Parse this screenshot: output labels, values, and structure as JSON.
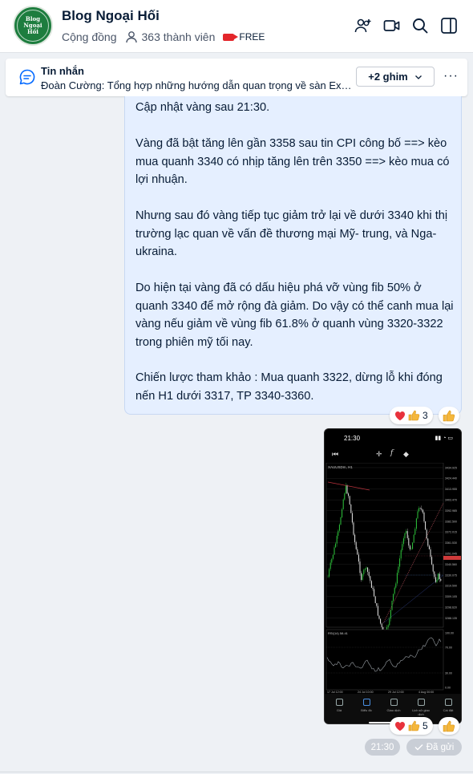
{
  "header": {
    "avatar_line1": "Blog",
    "avatar_line2": "Ngoại Hối",
    "title": "Blog Ngoại Hối",
    "category": "Cộng đồng",
    "members": "363 thành viên",
    "badge": "FREE",
    "icons": [
      "add-member-icon",
      "video-call-icon",
      "search-icon",
      "sidebar-toggle-icon"
    ]
  },
  "pinned": {
    "title": "Tin nhắn",
    "text": "Đoàn Cường: Tổng hợp những hướng dẫn quan trọng về sàn Exness",
    "pins_label": "+2 ghim",
    "more": "···"
  },
  "message": {
    "paragraphs": [
      "Cập nhật vàng sau 21:30.",
      "Vàng đã bật tăng lên gần 3358 sau tin CPI công bố ==> kèo mua quanh 3340 có nhịp tăng lên trên 3350 ==> kèo mua có lợi nhuận.",
      "Nhưng sau đó vàng tiếp tục giảm trở lại về dưới 3340 khi thị trường lạc quan về vấn đề thương mại Mỹ- trung, và Nga-ukraina.",
      "Do hiện tại vàng đã có dấu hiệu phá vỡ vùng fib 50% ở quanh 3340 để mở rộng đà giảm. Do vậy có thể canh mua lại vàng nếu giảm về vùng fib 61.8% ở quanh vùng 3320-3322 trong phiên mỹ tối nay.",
      "Chiến lược tham khảo : Mua quanh 3322, dừng lỗ khi đóng nến H1 dưới 3317, TP 3340-3360."
    ],
    "reaction_count": "3"
  },
  "image_message": {
    "status_time": "21:30",
    "symbol_label": "XAUUSDm, H1",
    "indicator_label": "RSI(14) 58.41",
    "price_ticks": [
      "3434.925",
      "3424.440",
      "3413.955",
      "3403.470",
      "3392.985",
      "3382.500",
      "3372.015",
      "3361.530",
      "3351.045",
      "3340.560",
      "3330.075",
      "3319.590",
      "3309.105",
      "3298.620",
      "3288.135"
    ],
    "rsi_ticks": [
      "100.00",
      "70.00",
      "30.00",
      "0.00"
    ],
    "date_ticks": [
      "17 Jul 12:00",
      "24 Jul 10:00",
      "29 Jul 12:00",
      "4 Aug 00:00"
    ],
    "nav_items": [
      "Giá",
      "Biểu đồ",
      "Giao dịch",
      "Lịch sử giao dịch",
      "Cài đặt"
    ],
    "reaction_count": "5"
  },
  "meta": {
    "time": "21:30",
    "status": "Đã gửi"
  },
  "colors": {
    "bubble": "#e5efff",
    "accent": "#1d7d3e",
    "free_badge": "#e3262b",
    "candle_up": "#2ec73c"
  }
}
